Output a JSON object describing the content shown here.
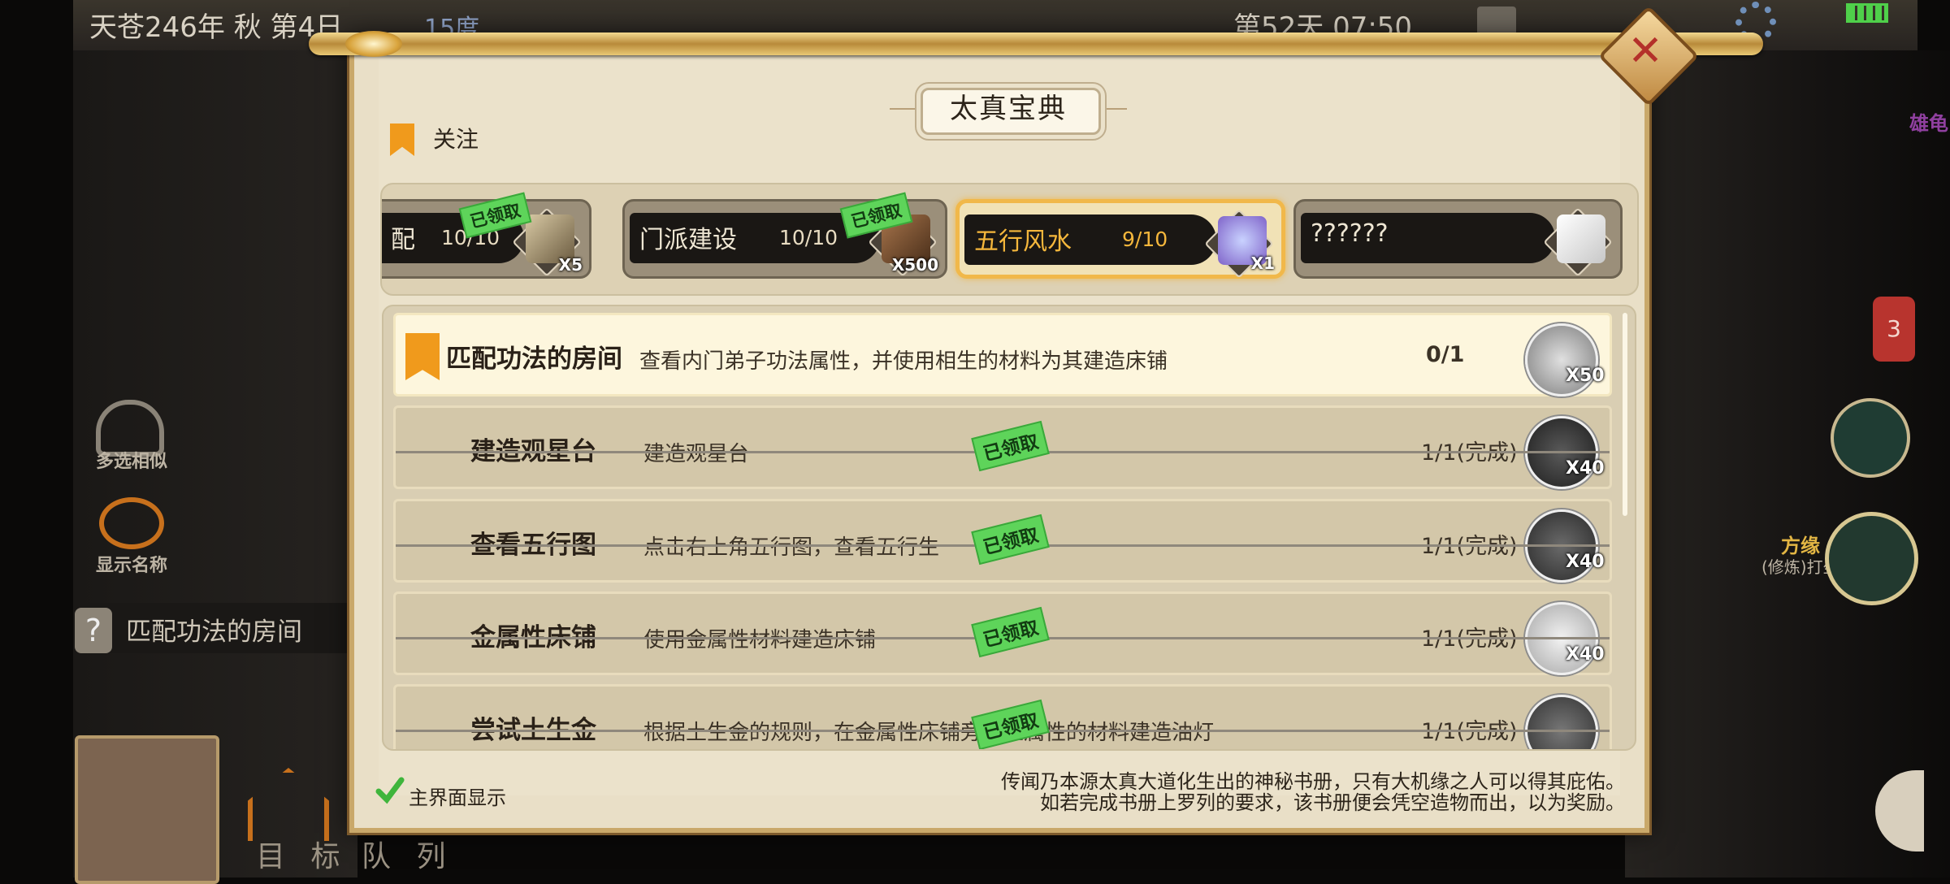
{
  "hud": {
    "date": "天苍246年 秋 第4日",
    "temperature": "15度",
    "day_time": "第52天 07:50",
    "left": {
      "multi_select": "多选相似",
      "show_names": "显示名称",
      "current_quest": "匹配功法的房间",
      "target_btn": "目 标",
      "queue_btn": "队 列"
    },
    "right": {
      "bubble_count": "3",
      "character_name": "方缘",
      "character_status": "(修炼)打坐",
      "edge_name": "雄龟"
    }
  },
  "modal": {
    "title": "太真宝典",
    "follow_label": "关注",
    "tabs": [
      {
        "name": "配",
        "progress": "10/10",
        "qty": "X5",
        "stamp": "已领取",
        "state": "claimed",
        "icon": "scroll-icon"
      },
      {
        "name": "门派建设",
        "progress": "10/10",
        "qty": "X500",
        "stamp": "已领取",
        "state": "claimed",
        "icon": "wood-planks-icon"
      },
      {
        "name": "五行风水",
        "progress": "9/10",
        "qty": "X1",
        "stamp": "",
        "state": "active",
        "icon": "crystal-icon"
      },
      {
        "name": "??????",
        "progress": "",
        "qty": "",
        "stamp": "",
        "state": "locked",
        "icon": "silver-block-icon"
      }
    ],
    "tasks": [
      {
        "name": "匹配功法的房间",
        "desc": "查看内门弟子功法属性，并使用相生的材料为其建造床铺",
        "progress": "0/1",
        "reward_qty": "X50",
        "stamp": "",
        "state": "current"
      },
      {
        "name": "建造观星台",
        "desc": "建造观星台",
        "progress": "1/1(完成)",
        "reward_qty": "X40",
        "stamp": "已领取",
        "state": "done"
      },
      {
        "name": "查看五行图",
        "desc": "点击右上角五行图，查看五行生",
        "progress": "1/1(完成)",
        "reward_qty": "X40",
        "stamp": "已领取",
        "state": "done"
      },
      {
        "name": "金属性床铺",
        "desc": "使用金属性材料建造床铺",
        "progress": "1/1(完成)",
        "reward_qty": "X40",
        "stamp": "已领取",
        "state": "done"
      },
      {
        "name": "尝试土生金",
        "desc": "根据土生金的规则，在金属性床铺旁用土属性的材料建造油灯",
        "progress": "1/1(完成)",
        "reward_qty": "",
        "stamp": "已领取",
        "state": "done"
      }
    ],
    "show_on_main_label": "主界面显示",
    "show_on_main_checked": true,
    "lore_line1": "传闻乃本源太真大道化生出的神秘书册，只有大机缘之人可以得其庇佑。",
    "lore_line2": "如若完成书册上罗列的要求，该书册便会凭空造物而出，以为奖励。"
  },
  "colors": {
    "accent_orange": "#f09a1c",
    "claimed_green": "#5ed45a",
    "active_gold": "#f1b84a",
    "parchment": "#e9dfc7"
  }
}
